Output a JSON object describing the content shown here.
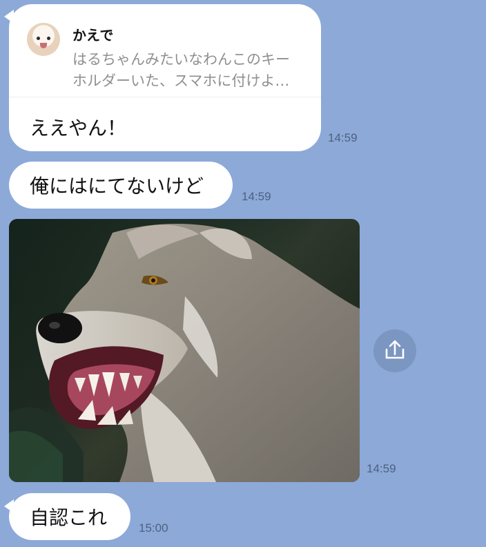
{
  "reply_message": {
    "quoted_author": "かえで",
    "quoted_text_line1": "はるちゃんみたいなわんこのキー",
    "quoted_text_line2": "ホルダーいた、スマホに付けよ…",
    "text": "ええやん！",
    "time": "14:59"
  },
  "message_2": {
    "text": "俺にはにてないけど",
    "time": "14:59"
  },
  "photo_message": {
    "subject": "snarling wolf",
    "time": "14:59",
    "share_icon": "share-icon"
  },
  "message_3": {
    "text": "自認これ",
    "time": "15:00"
  }
}
